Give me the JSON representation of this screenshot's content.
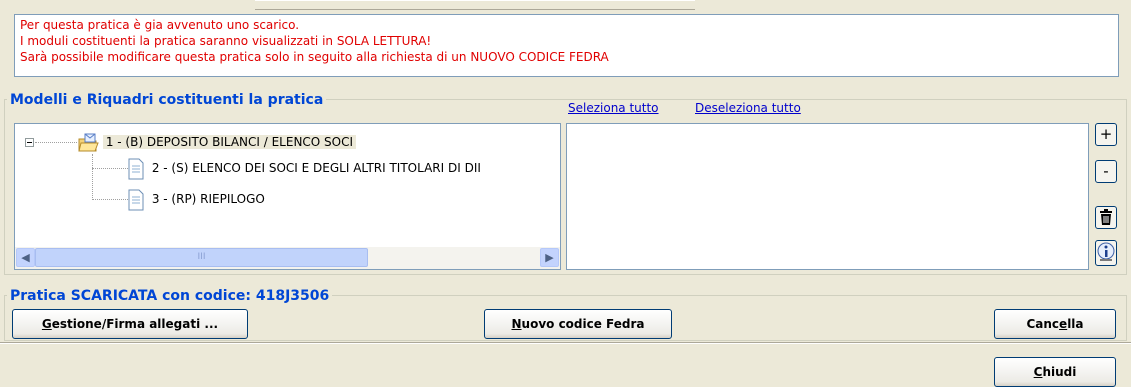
{
  "notice": {
    "lines": [
      "Per questa pratica è gia avvenuto uno scarico.",
      "I moduli costituenti la pratica saranno visualizzati in SOLA LETTURA!",
      "Sarà possibile modificare questa pratica solo in seguito alla richiesta di un NUOVO CODICE FEDRA"
    ]
  },
  "models": {
    "title": "Modelli e Riquadri costituenti la pratica",
    "select_all": "Seleziona tutto",
    "deselect_all": "Deseleziona tutto",
    "tree": [
      {
        "label": "1 - (B) DEPOSITO BILANCI / ELENCO SOCI",
        "icon": "open-folder-envelope-icon",
        "selected": true
      },
      {
        "label": "2 - (S) ELENCO DEI SOCI E DEGLI ALTRI TITOLARI DI DII",
        "icon": "document-icon"
      },
      {
        "label": "3 - (RP) RIEPILOGO",
        "icon": "document-icon"
      }
    ],
    "side_buttons": {
      "add": "+",
      "remove": "-",
      "delete_icon": "trash-icon",
      "info_icon": "info-icon"
    },
    "scroll_grip": "III"
  },
  "pratica": {
    "title": "Pratica SCARICATA con codice: 418J3506"
  },
  "buttons": {
    "gestione_prefix": "G",
    "gestione_rest": "estione/Firma allegati ...",
    "nuovo_prefix": "N",
    "nuovo_rest": "uovo codice Fedra",
    "cancella_start": "Canc",
    "cancella_mid": "e",
    "cancella_end": "lla",
    "chiudi_prefix": "C",
    "chiudi_rest": "hiudi"
  },
  "colors": {
    "notice_text": "#e00000",
    "group_title": "#0046d5",
    "link": "#0000cc"
  }
}
